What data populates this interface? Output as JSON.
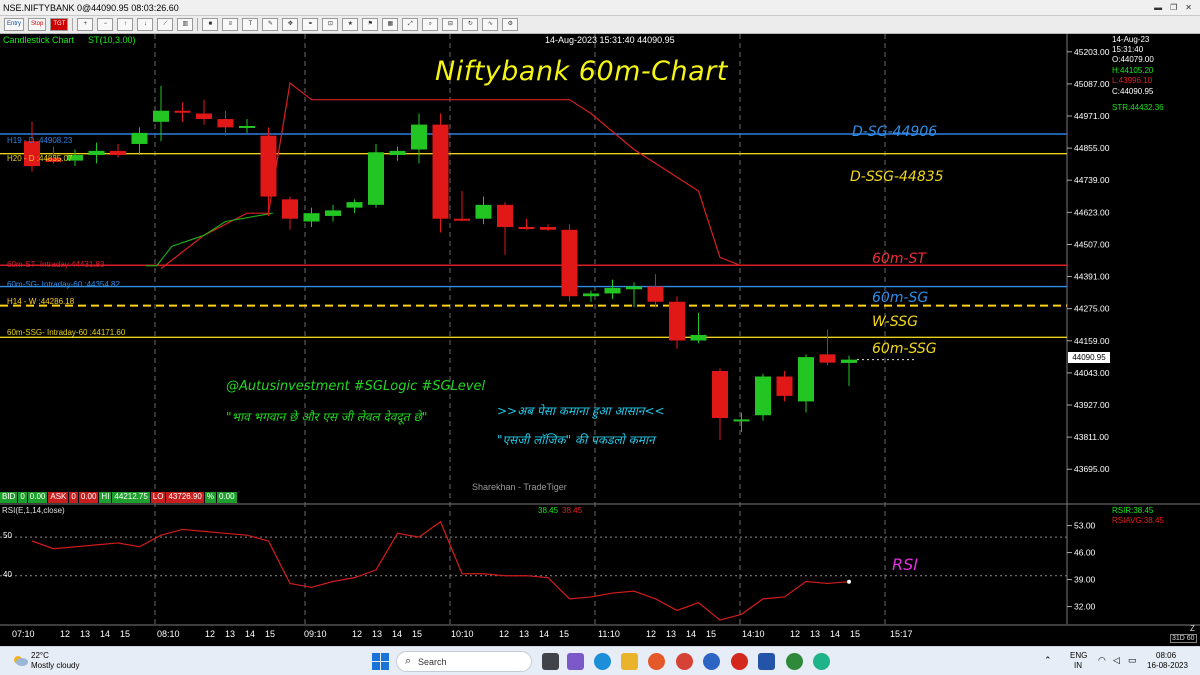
{
  "window": {
    "title": "NSE.NIFTYBANK 0@44090.95 08:03:26.60"
  },
  "toolbar": {
    "entry": "Entry",
    "stop": "Stop",
    "tgt": "TGT"
  },
  "chart_header": {
    "chart_type": "Candlestick Chart",
    "indicator": "ST(10,3.00)",
    "timestamp": "14-Aug-2023 15:31:40 44090.95",
    "title": "Niftybank 60m-Chart"
  },
  "ohlc_panel": {
    "date": "14-Aug-23",
    "time": "15:31:40",
    "open": "O:44079.00",
    "high": "H:44105.20",
    "low": "L:43996.10",
    "close": "C:44090.95",
    "str": "STR:44432.36"
  },
  "levels": [
    {
      "label": "H19 - D :44908.23",
      "tag": "D-SG-44906",
      "price": 44906,
      "color": "#2f7fe0"
    },
    {
      "label": "H20 - D :44835.07",
      "tag": "D-SSG-44835",
      "price": 44835,
      "color": "#e8d21a"
    },
    {
      "label": "60m-ST- Intraday:44431.83",
      "tag": "60m-ST",
      "price": 44431.83,
      "color": "#d81d2a"
    },
    {
      "label": "60m-SG- Intraday-60 :44354.82",
      "tag": "60m-SG",
      "price": 44354.82,
      "color": "#2f8fe8"
    },
    {
      "label": "H14 - W :44286.18",
      "tag": "W-SSG",
      "price": 44286.18,
      "color": "#ffd21a"
    },
    {
      "label": "60m-SSG- Intraday-60 :44171.60",
      "tag": "60m-SSG",
      "price": 44171.6,
      "color": "#e8d21a"
    }
  ],
  "price_axis": {
    "ticks": [
      "45203.00",
      "45087.00",
      "44971.00",
      "44855.00",
      "44739.00",
      "44623.00",
      "44507.00",
      "44391.00",
      "44275.00",
      "44159.00",
      "44043.00",
      "43927.00",
      "43811.00",
      "43695.00"
    ],
    "current": "44090.95"
  },
  "annotations": {
    "handles": "@Autusinvestment  #SGLogic  #SGLevel",
    "quote1": "\"भाव भगवान छे और एस जी लेवल देवदूत छे\"",
    "quote2": ">>अब पेसा कमाना हुआ आसान<<",
    "quote3": "\"एसजी लॉजिक\" की पकडलो कमान",
    "watermark": "Sharekhan - TradeTiger",
    "rsi_tag": "RSI"
  },
  "bid_bar": {
    "bid_label": "BID",
    "bid_qty": "0",
    "bid_price": "0.00",
    "ask_label": "ASK",
    "ask_qty": "0",
    "ask_price": "0.00",
    "hi": "HI",
    "hi_val": "44212.75",
    "lo": "LO",
    "lo_val": "43726.90",
    "pct": "%",
    "pct_val": "0.00"
  },
  "rsi": {
    "title": "RSI(E,1,14,close)",
    "value": "38.45",
    "avg": "38.45",
    "rsir": "RSIR:38.45",
    "rsiavg": "RSIAVG:38.45",
    "ticks": [
      "53.00",
      "46.00",
      "39.00",
      "32.00"
    ],
    "levels": [
      "50",
      "40"
    ]
  },
  "time_axis": {
    "labels": [
      "07:10",
      "12",
      "13",
      "14",
      "15",
      "08:10",
      "12",
      "13",
      "14",
      "15",
      "09:10",
      "12",
      "13",
      "14",
      "15",
      "10:10",
      "12",
      "13",
      "14",
      "15",
      "11:10",
      "12",
      "13",
      "14",
      "15",
      "14:10",
      "12",
      "13",
      "14",
      "15",
      "15:17"
    ],
    "right_z": "Z",
    "right_tag": "31D 60"
  },
  "chart_data": {
    "type": "candlestick",
    "title": "Niftybank 60m-Chart",
    "ylim": [
      43620,
      45260
    ],
    "candles": [
      {
        "o": 44880,
        "h": 44950,
        "l": 44770,
        "c": 44790
      },
      {
        "o": 44820,
        "h": 44860,
        "l": 44800,
        "c": 44805
      },
      {
        "o": 44810,
        "h": 44850,
        "l": 44790,
        "c": 44830
      },
      {
        "o": 44830,
        "h": 44875,
        "l": 44800,
        "c": 44845
      },
      {
        "o": 44845,
        "h": 44870,
        "l": 44820,
        "c": 44830
      },
      {
        "o": 44870,
        "h": 44930,
        "l": 44830,
        "c": 44910
      },
      {
        "o": 44950,
        "h": 45080,
        "l": 44880,
        "c": 44990
      },
      {
        "o": 44990,
        "h": 45020,
        "l": 44950,
        "c": 44985
      },
      {
        "o": 44980,
        "h": 45030,
        "l": 44940,
        "c": 44960
      },
      {
        "o": 44960,
        "h": 44990,
        "l": 44900,
        "c": 44930
      },
      {
        "o": 44930,
        "h": 44960,
        "l": 44910,
        "c": 44935
      },
      {
        "o": 44900,
        "h": 44930,
        "l": 44610,
        "c": 44680
      },
      {
        "o": 44670,
        "h": 44680,
        "l": 44560,
        "c": 44600
      },
      {
        "o": 44590,
        "h": 44640,
        "l": 44570,
        "c": 44620
      },
      {
        "o": 44610,
        "h": 44650,
        "l": 44590,
        "c": 44630
      },
      {
        "o": 44640,
        "h": 44670,
        "l": 44620,
        "c": 44660
      },
      {
        "o": 44650,
        "h": 44870,
        "l": 44640,
        "c": 44840
      },
      {
        "o": 44830,
        "h": 44860,
        "l": 44810,
        "c": 44845
      },
      {
        "o": 44850,
        "h": 44980,
        "l": 44800,
        "c": 44940
      },
      {
        "o": 44940,
        "h": 44980,
        "l": 44550,
        "c": 44600
      },
      {
        "o": 44600,
        "h": 44700,
        "l": 44590,
        "c": 44595
      },
      {
        "o": 44600,
        "h": 44680,
        "l": 44580,
        "c": 44650
      },
      {
        "o": 44650,
        "h": 44660,
        "l": 44470,
        "c": 44570
      },
      {
        "o": 44570,
        "h": 44600,
        "l": 44560,
        "c": 44565
      },
      {
        "o": 44570,
        "h": 44580,
        "l": 44555,
        "c": 44560
      },
      {
        "o": 44560,
        "h": 44580,
        "l": 44300,
        "c": 44320
      },
      {
        "o": 44320,
        "h": 44340,
        "l": 44300,
        "c": 44330
      },
      {
        "o": 44330,
        "h": 44380,
        "l": 44310,
        "c": 44350
      },
      {
        "o": 44345,
        "h": 44370,
        "l": 44280,
        "c": 44355
      },
      {
        "o": 44355,
        "h": 44400,
        "l": 44280,
        "c": 44300
      },
      {
        "o": 44300,
        "h": 44320,
        "l": 44130,
        "c": 44160
      },
      {
        "o": 44160,
        "h": 44260,
        "l": 44150,
        "c": 44180
      },
      {
        "o": 44050,
        "h": 44060,
        "l": 43800,
        "c": 43880
      },
      {
        "o": 43870,
        "h": 43900,
        "l": 43830,
        "c": 43875
      },
      {
        "o": 43890,
        "h": 44040,
        "l": 43870,
        "c": 44030
      },
      {
        "o": 44030,
        "h": 44050,
        "l": 43940,
        "c": 43960
      },
      {
        "o": 43940,
        "h": 44110,
        "l": 43900,
        "c": 44100
      },
      {
        "o": 44110,
        "h": 44200,
        "l": 44070,
        "c": 44080
      },
      {
        "o": 44079,
        "h": 44105.2,
        "l": 43996.1,
        "c": 44090.95
      }
    ],
    "supertrend": [
      {
        "i": 6,
        "v": 44420
      },
      {
        "i": 8,
        "v": 44540
      },
      {
        "i": 10,
        "v": 44620
      },
      {
        "i": 11,
        "v": 44620
      },
      {
        "i": 12,
        "v": 45090
      },
      {
        "i": 13,
        "v": 45030
      },
      {
        "i": 24,
        "v": 45030
      },
      {
        "i": 25,
        "v": 45030
      },
      {
        "i": 26,
        "v": 44980
      },
      {
        "i": 28,
        "v": 44850
      },
      {
        "i": 31,
        "v": 44700
      },
      {
        "i": 32,
        "v": 44460
      },
      {
        "i": 33,
        "v": 44430
      }
    ],
    "supertrend_start": [
      {
        "i": 5.8,
        "v": 44430
      },
      {
        "i": 6.5,
        "v": 44500
      },
      {
        "i": 8,
        "v": 44540
      },
      {
        "i": 9,
        "v": 44590
      },
      {
        "i": 11.2,
        "v": 44620
      }
    ],
    "rsi_values": [
      49,
      47,
      47.5,
      48,
      48.5,
      47.5,
      50.5,
      52,
      51.5,
      51,
      50.5,
      49,
      38,
      37,
      38.5,
      39.5,
      41.5,
      51,
      50,
      54,
      40.5,
      40.5,
      40,
      40,
      39.5,
      34,
      34.5,
      35.5,
      36,
      34,
      31,
      33,
      28.5,
      30,
      34,
      34.5,
      38.5,
      38,
      38.45
    ],
    "rsi_ylim": [
      28,
      56
    ],
    "rsi_levels": [
      50,
      40
    ]
  }
}
